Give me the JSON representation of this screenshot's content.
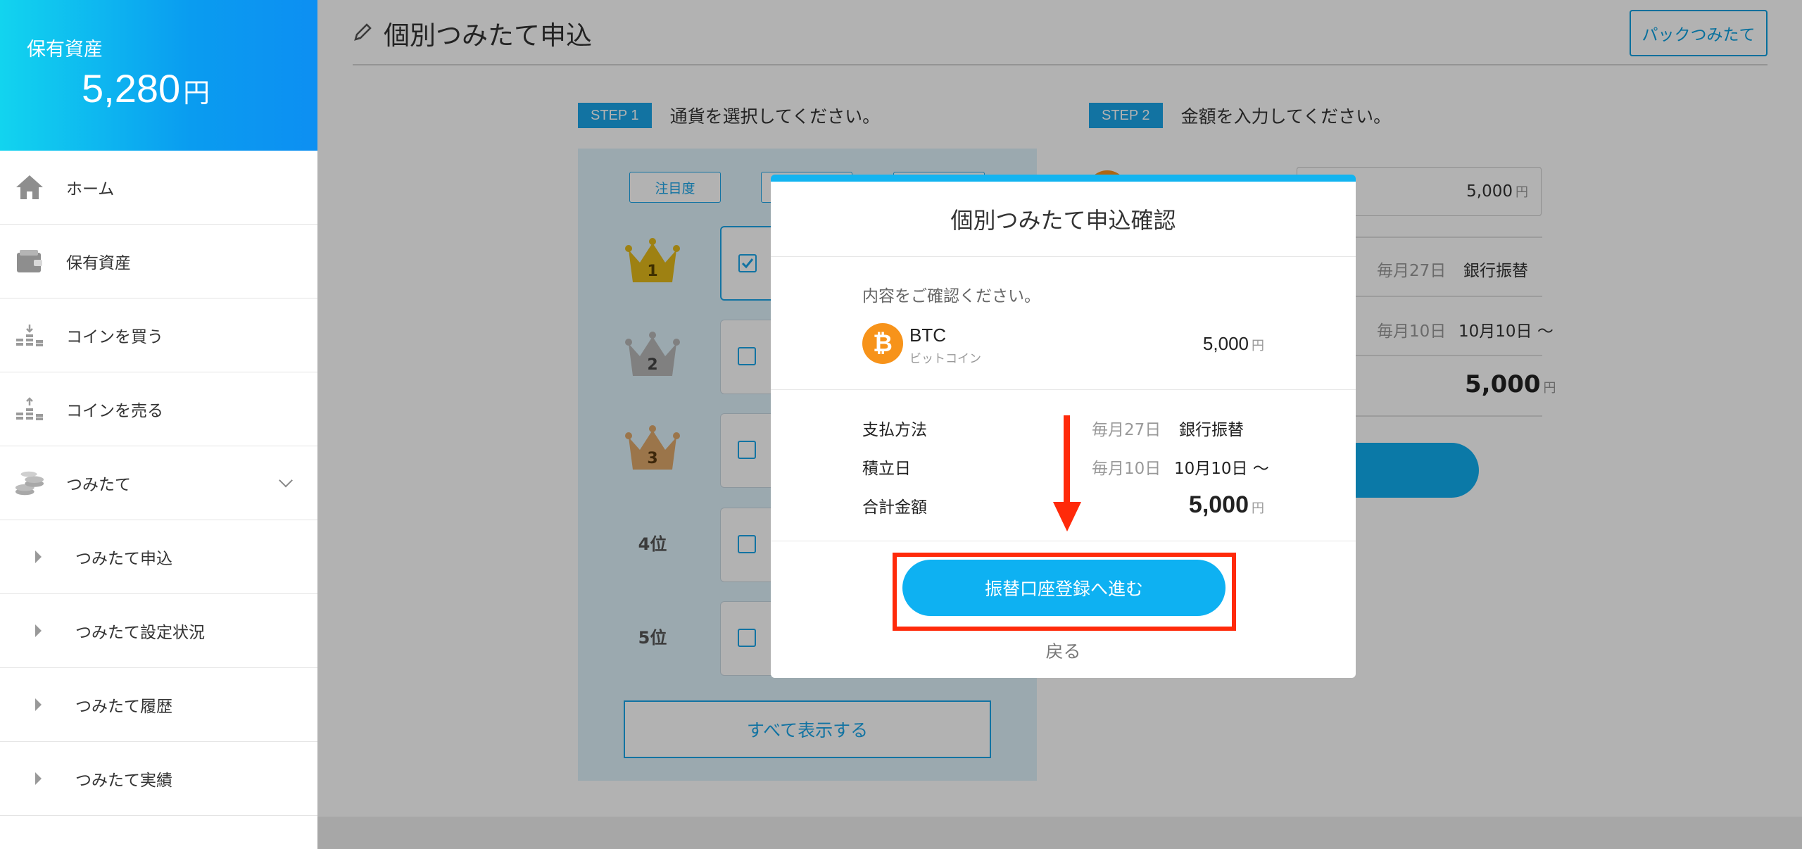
{
  "sidebar": {
    "asset_label": "保有資産",
    "asset_value": "5,280",
    "asset_unit": "円",
    "nav": [
      {
        "label": "ホーム",
        "icon": "home-icon"
      },
      {
        "label": "保有資産",
        "icon": "wallet-icon"
      },
      {
        "label": "コインを買う",
        "icon": "coin-buy-icon"
      },
      {
        "label": "コインを売る",
        "icon": "coin-sell-icon"
      },
      {
        "label": "つみたて",
        "icon": "coins-stack-icon"
      }
    ],
    "sub_items": [
      {
        "label": "つみたて申込"
      },
      {
        "label": "つみたて設定状況"
      },
      {
        "label": "つみたて履歴"
      },
      {
        "label": "つみたて実績"
      }
    ]
  },
  "page": {
    "title": "個別つみたて申込",
    "pack_button": "パックつみたて"
  },
  "step1": {
    "badge": "STEP 1",
    "text": "通貨を選択してください。",
    "sort_tab": "注目度",
    "ranks": [
      {
        "label": "1"
      },
      {
        "label": "2"
      },
      {
        "label": "3"
      },
      {
        "label": "4位"
      },
      {
        "label": "5位"
      }
    ],
    "show_all": "すべて表示する"
  },
  "step2": {
    "badge": "STEP 2",
    "text": "金額を入力してください。",
    "amount": "5,000",
    "amount_unit": "円",
    "pay_day": "毎月27日",
    "pay_method": "銀行振替",
    "accum_day": "毎月10日",
    "accum_start": "10月10日 〜",
    "total": "5,000",
    "total_unit": "円"
  },
  "modal": {
    "title": "個別つみたて申込確認",
    "confirm_text": "内容をご確認ください。",
    "coin_symbol": "BTC",
    "coin_name": "ビットコイン",
    "coin_icon_glyph": "₿",
    "coin_amount": "5,000",
    "coin_amount_unit": "円",
    "payment_label": "支払方法",
    "payment_day": "毎月27日",
    "payment_method": "銀行振替",
    "accum_label": "積立日",
    "accum_day": "毎月10日",
    "accum_start": "10月10日 〜",
    "total_label": "合計金額",
    "total_value": "5,000",
    "total_unit": "円",
    "primary_button": "振替口座登録へ進む",
    "back_link": "戻る"
  },
  "colors": {
    "accent": "#0eb1f2",
    "highlight": "#ff2a0a",
    "bitcoin": "#f7931a"
  }
}
